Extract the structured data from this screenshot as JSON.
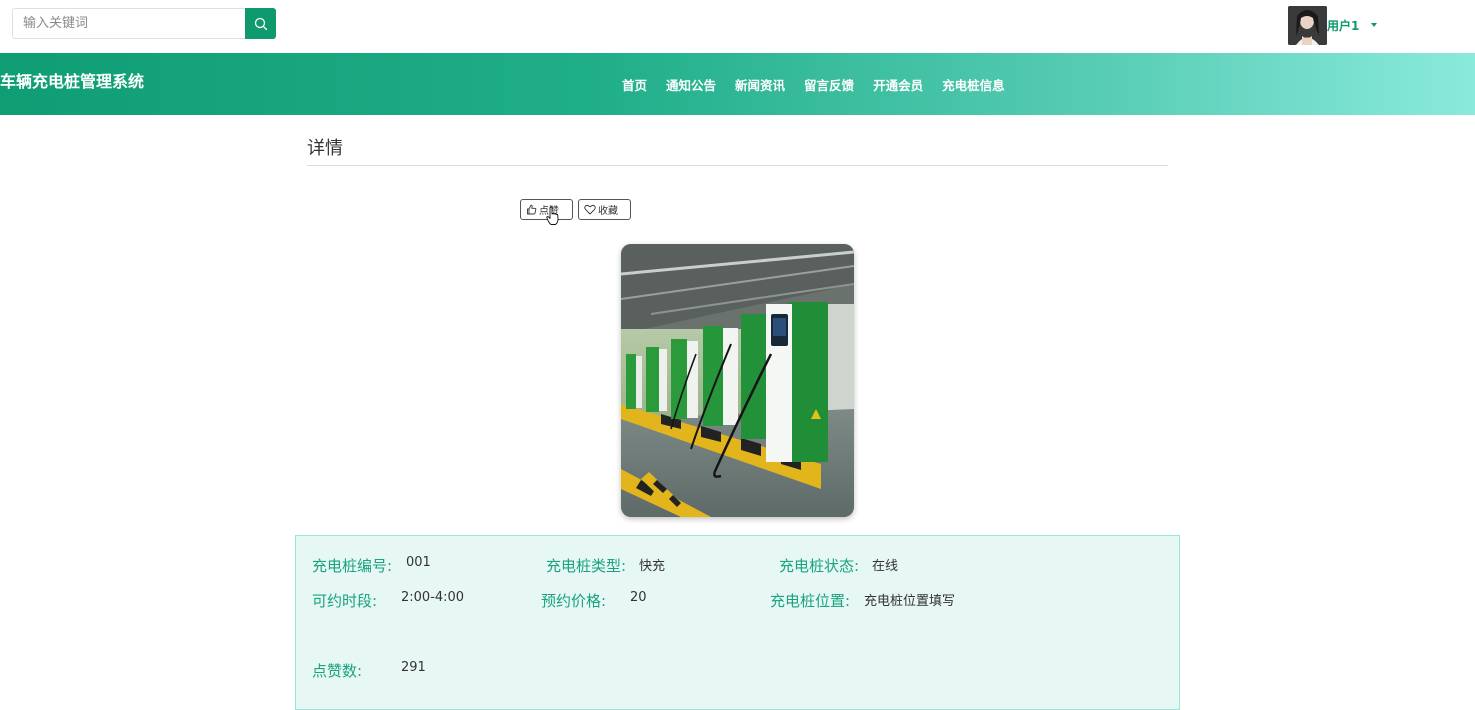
{
  "search": {
    "placeholder": "输入关键词"
  },
  "user": {
    "name": "用户1"
  },
  "brand": "车辆充电桩管理系统",
  "nav": [
    "首页",
    "通知公告",
    "新闻资讯",
    "留言反馈",
    "开通会员",
    "充电桩信息"
  ],
  "page": {
    "title": "详情"
  },
  "actions": {
    "like_label": "点赞",
    "favorite_label": "收藏"
  },
  "details": {
    "number_label": "充电桩编号:",
    "number_value": "001",
    "type_label": "充电桩类型:",
    "type_value": "快充",
    "status_label": "充电桩状态:",
    "status_value": "在线",
    "time_label": "可约时段:",
    "time_value": "2:00-4:00",
    "price_label": "预约价格:",
    "price_value": "20",
    "location_label": "充电桩位置:",
    "location_value": "充电桩位置填写",
    "likes_label": "点赞数:",
    "likes_value": "291"
  },
  "colors": {
    "accent": "#0e9a6e",
    "label": "#19a37e",
    "panel_bg": "#e6f7f4"
  }
}
